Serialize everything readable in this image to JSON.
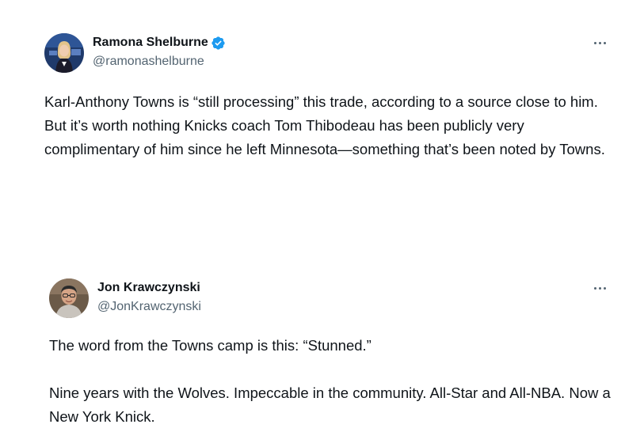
{
  "tweets": [
    {
      "author": {
        "display_name": "Ramona Shelburne",
        "handle": "@ramonashelburne",
        "verified": true,
        "avatar_icon": "avatar-photo-woman"
      },
      "more_icon": "more-horizontal-icon",
      "text": [
        "Karl-Anthony Towns is “still processing” this trade, according to a source close to him. But it’s worth nothing Knicks coach Tom Thibodeau has been publicly very complimentary of him since he left Minnesota—something that’s been noted by Towns."
      ]
    },
    {
      "author": {
        "display_name": "Jon Krawczynski",
        "handle": "@JonKrawczynski",
        "verified": false,
        "avatar_icon": "avatar-photo-man"
      },
      "more_icon": "more-horizontal-icon",
      "text": [
        "The word from the Towns camp is this: “Stunned.”",
        "Nine years with the Wolves. Impeccable in the community. All-Star and All-NBA. Now a New York Knick."
      ]
    }
  ],
  "colors": {
    "verified_badge": "#1d9bf0",
    "text_primary": "#0f1419",
    "text_secondary": "#536471"
  }
}
